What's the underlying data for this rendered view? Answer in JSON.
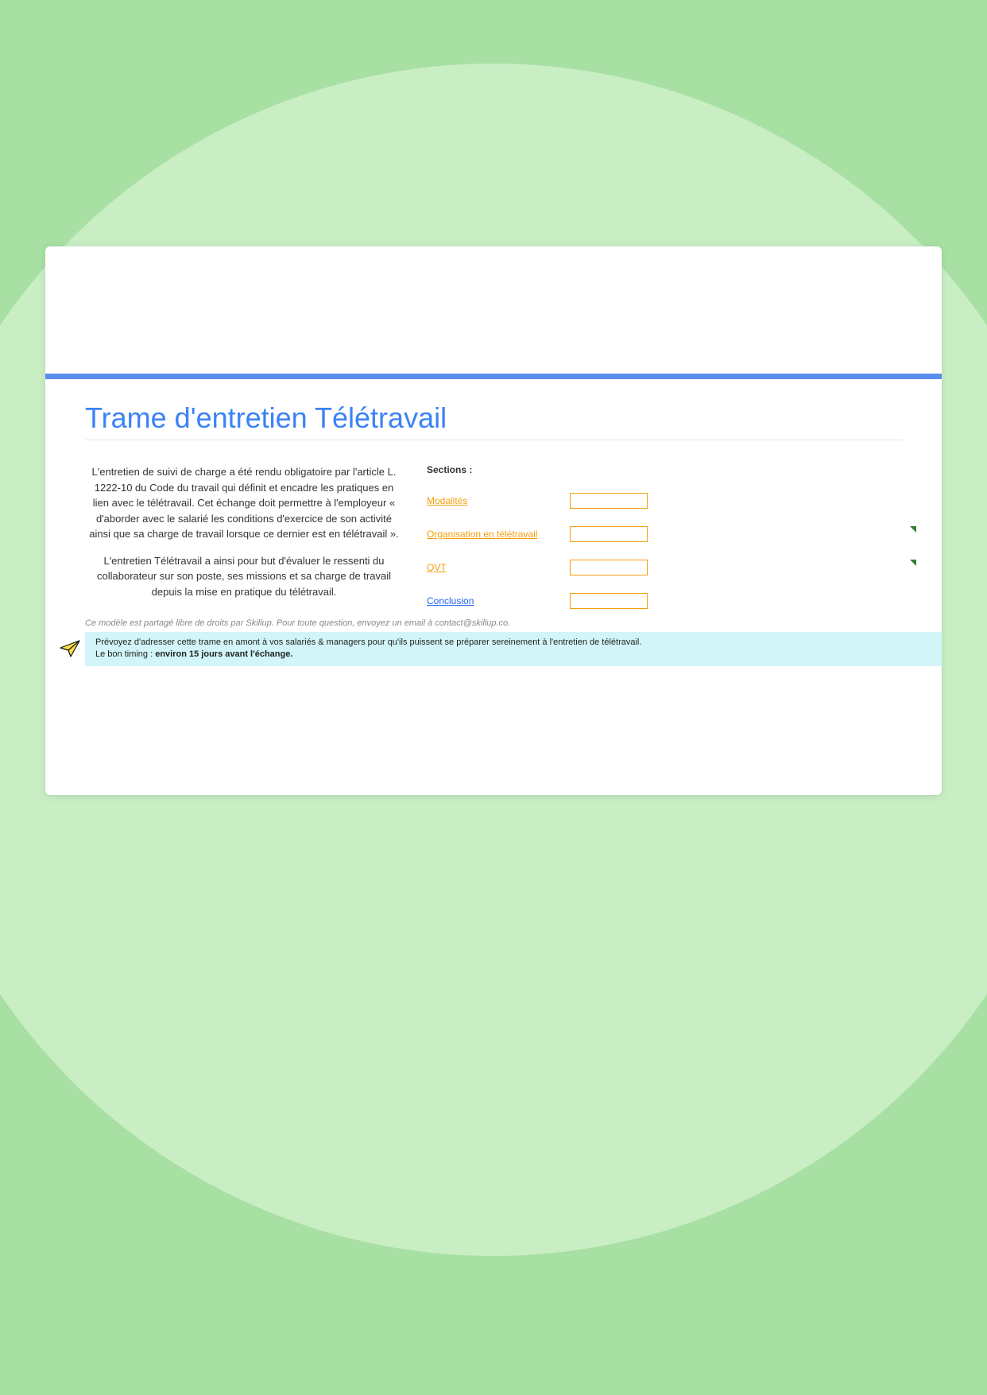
{
  "page": {
    "title": "Trame d'entretien Télétravail"
  },
  "intro": {
    "p1": "L'entretien de suivi de charge a été rendu obligatoire par l'article L. 1222-10 du Code du travail qui définit et encadre les pratiques en lien avec le télétravail. Cet échange doit permettre à l'employeur « d'aborder avec le salarié les conditions d'exercice de son activité ainsi que sa charge de travail lorsque ce dernier est en télétravail ».",
    "p2": "L'entretien Télétravail a ainsi pour but d'évaluer le ressenti du collaborateur sur son poste, ses missions et sa charge de travail depuis la mise en pratique du télétravail."
  },
  "sections": {
    "label": "Sections :",
    "items": [
      {
        "label": "Modalités",
        "color": "orange",
        "mark": false
      },
      {
        "label": "Organisation en télétravail",
        "color": "orange",
        "mark": true
      },
      {
        "label": "QVT",
        "color": "orange",
        "mark": true
      },
      {
        "label": "Conclusion",
        "color": "blue",
        "mark": false
      }
    ]
  },
  "footer": {
    "note": "Ce modèle est partagé libre de droits par Skillup. Pour toute question, envoyez un email à contact@skillup.co."
  },
  "tip": {
    "line1": "Prévoyez d'adresser cette trame en amont à vos salariés & managers pour qu'ils puissent se préparer sereinement à l'entretien de télétravail.",
    "line2_prefix": "Le bon timing : ",
    "line2_bold": "environ 15 jours avant l'échange."
  }
}
